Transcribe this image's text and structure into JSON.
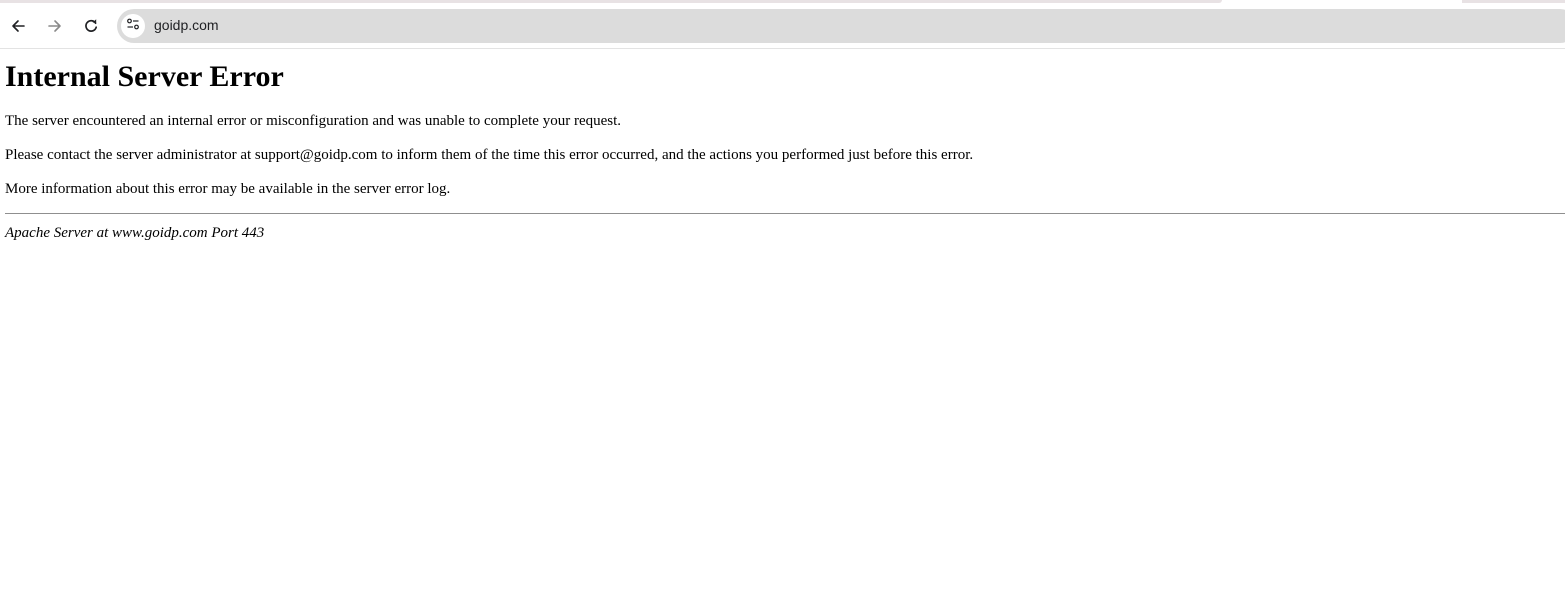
{
  "browser": {
    "url": "goidp.com",
    "icons": {
      "back": "arrow-left-icon",
      "forward": "arrow-right-icon",
      "reload": "reload-icon",
      "site_info": "tune-icon"
    },
    "colors": {
      "omnibox_bg": "#dcdcdc",
      "icon_active": "#202124",
      "icon_disabled": "#8a8a8a"
    }
  },
  "page": {
    "heading": "Internal Server Error",
    "paragraphs": [
      "The server encountered an internal error or misconfiguration and was unable to complete your request.",
      "Please contact the server administrator at support@goidp.com to inform them of the time this error occurred, and the actions you performed just before this error.",
      "More information about this error may be available in the server error log."
    ],
    "signature": "Apache Server at www.goidp.com Port 443"
  }
}
